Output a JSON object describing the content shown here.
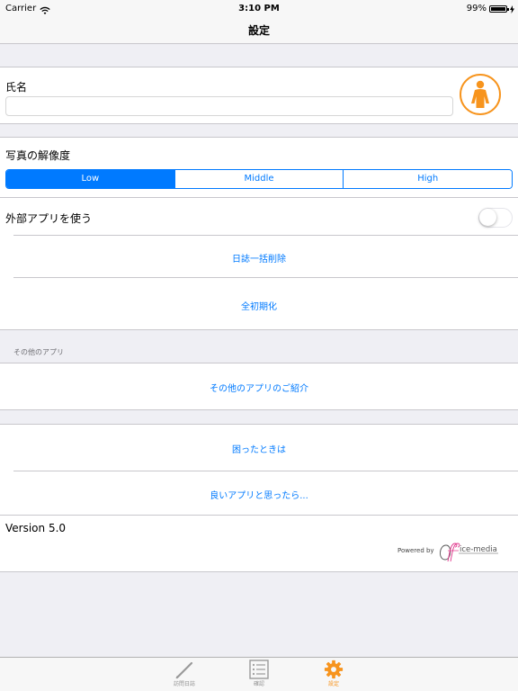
{
  "status": {
    "carrier": "Carrier",
    "time": "3:10 PM",
    "battery_text": "99%",
    "battery_level": 0.99
  },
  "nav": {
    "title": "設定"
  },
  "name_section": {
    "label": "氏名",
    "input_value": "",
    "input_placeholder": ""
  },
  "photo_section": {
    "label": "写真の解像度",
    "options": [
      "Low",
      "Middle",
      "High"
    ],
    "selected": "Low",
    "external_app_label": "外部アプリを使う",
    "external_app_enabled": false,
    "delete_logs": "日誌一括削除",
    "reset_all": "全初期化"
  },
  "other_apps": {
    "header": "その他のアプリ",
    "intro": "その他のアプリのご紹介"
  },
  "help": {
    "trouble": "困ったときは",
    "review": "良いアプリと思ったら..."
  },
  "footer": {
    "version": "Version 5.0",
    "powered_by": "Powered by",
    "brand": "office-media"
  },
  "tabs": [
    {
      "label": "訪問日誌",
      "icon": "pencil-icon",
      "active": false
    },
    {
      "label": "確認",
      "icon": "list-icon",
      "active": false
    },
    {
      "label": "設定",
      "icon": "gear-icon",
      "active": true
    }
  ],
  "colors": {
    "accent": "#007aff",
    "brand_orange": "#f7941d",
    "background": "#efeff4"
  }
}
